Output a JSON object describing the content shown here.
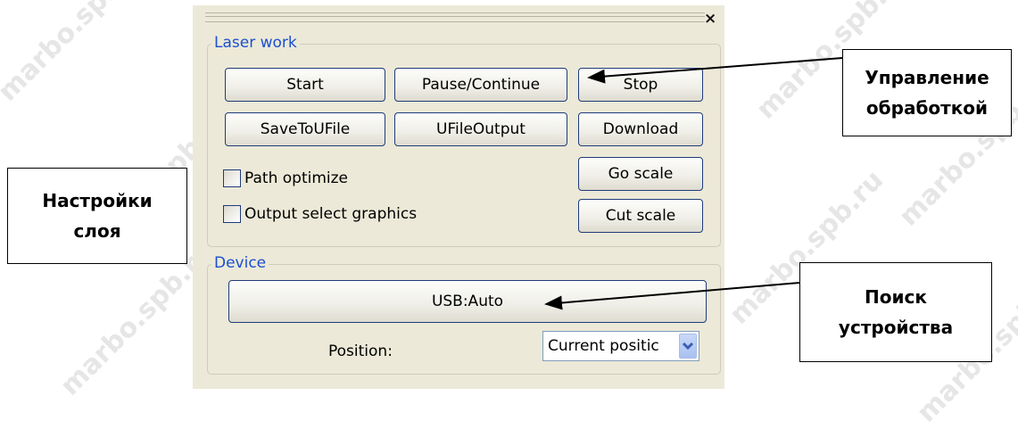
{
  "watermark": "marbo.spb.ru",
  "toolbar": {
    "close_glyph": "×"
  },
  "laser_work": {
    "legend": "Laser work",
    "start": "Start",
    "pause_continue": "Pause/Continue",
    "stop": "Stop",
    "save_to_ufile": "SaveToUFile",
    "ufile_output": "UFileOutput",
    "download": "Download",
    "path_optimize": {
      "label": "Path optimize",
      "checked": false
    },
    "output_select_graphics": {
      "label": "Output select graphics",
      "checked": false
    },
    "go_scale": "Go scale",
    "cut_scale": "Cut scale"
  },
  "device": {
    "legend": "Device",
    "usb": "USB:Auto",
    "position_label": "Position:",
    "position_value": "Current positic"
  },
  "callouts": {
    "processing_line1": "Управление",
    "processing_line2": "обработкой",
    "layer_line1": "Настройки",
    "layer_line2": "слоя",
    "device_line1": "Поиск",
    "device_line2": "устройства"
  },
  "icons": [
    "close-icon",
    "chevron-down-icon"
  ],
  "colors": {
    "panel_bg": "#ece9d8",
    "legend": "#1a4fd0",
    "button_border": "#1f3c7a"
  }
}
